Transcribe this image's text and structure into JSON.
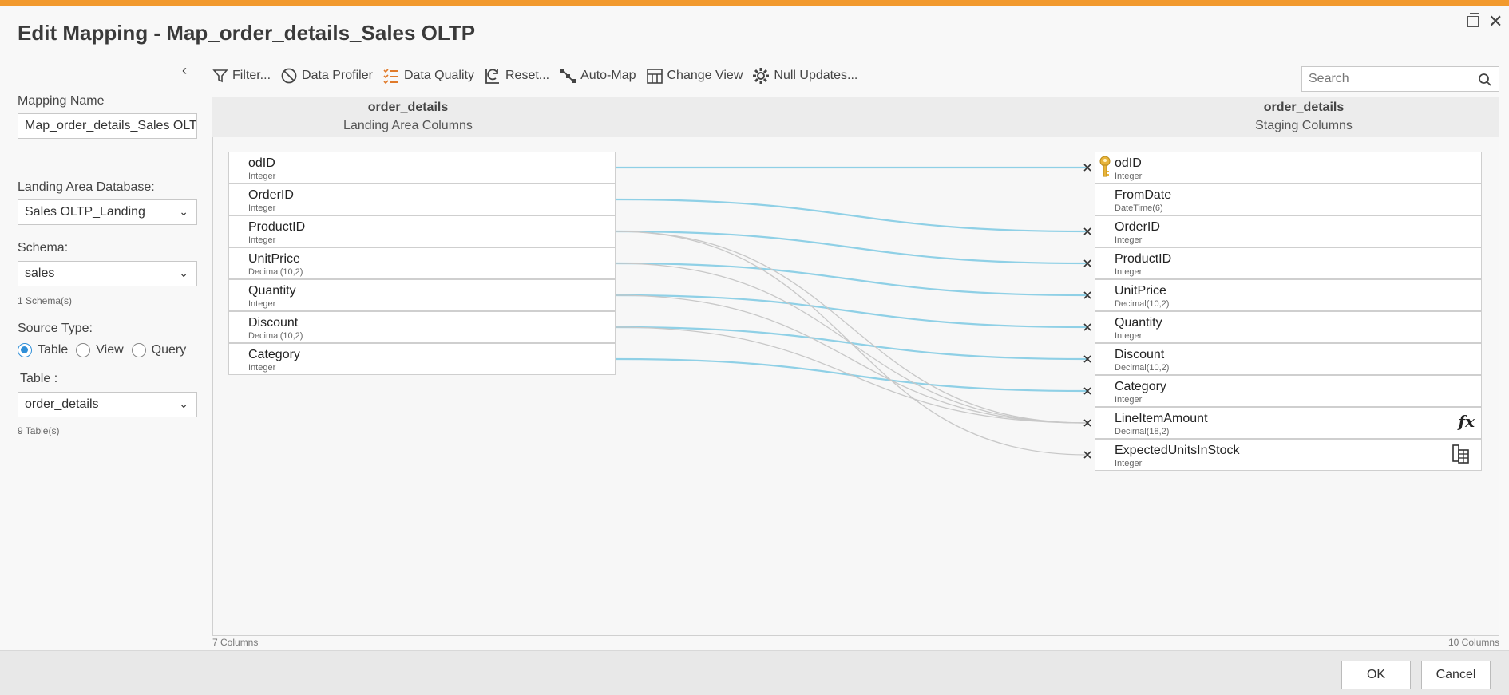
{
  "window": {
    "title": "Edit Mapping - Map_order_details_Sales OLTP"
  },
  "left_panel": {
    "mapping_name_label": "Mapping Name",
    "mapping_name_value": "Map_order_details_Sales OLTP",
    "landing_db_label": "Landing Area Database:",
    "landing_db_value": "Sales OLTP_Landing",
    "schema_label": "Schema:",
    "schema_value": "sales",
    "schema_count": "1 Schema(s)",
    "source_type_label": "Source Type:",
    "source_types": [
      "Table",
      "View",
      "Query"
    ],
    "source_type_selected": "Table",
    "table_label": "Table :",
    "table_value": "order_details",
    "table_count": "9 Table(s)"
  },
  "toolbar": {
    "items": [
      {
        "label": "Filter...",
        "icon": "filter-icon"
      },
      {
        "label": "Data Profiler",
        "icon": "data-profiler-icon"
      },
      {
        "label": "Data Quality",
        "icon": "data-quality-icon"
      },
      {
        "label": "Reset...",
        "icon": "reset-icon"
      },
      {
        "label": "Auto-Map",
        "icon": "auto-map-icon"
      },
      {
        "label": "Change View",
        "icon": "change-view-icon"
      },
      {
        "label": "Null Updates...",
        "icon": "gear-icon"
      }
    ],
    "search_placeholder": "Search"
  },
  "source": {
    "table_name": "order_details",
    "subtitle": "Landing Area Columns",
    "count": "7 Columns",
    "columns": [
      {
        "name": "odID",
        "type": "Integer"
      },
      {
        "name": "OrderID",
        "type": "Integer"
      },
      {
        "name": "ProductID",
        "type": "Integer"
      },
      {
        "name": "UnitPrice",
        "type": "Decimal(10,2)"
      },
      {
        "name": "Quantity",
        "type": "Integer"
      },
      {
        "name": "Discount",
        "type": "Decimal(10,2)"
      },
      {
        "name": "Category",
        "type": "Integer"
      }
    ]
  },
  "target": {
    "table_name": "order_details",
    "subtitle": "Staging Columns",
    "count": "10 Columns",
    "columns": [
      {
        "name": "odID",
        "type": "Integer",
        "icon": "key-icon"
      },
      {
        "name": "FromDate",
        "type": "DateTime(6)"
      },
      {
        "name": "OrderID",
        "type": "Integer"
      },
      {
        "name": "ProductID",
        "type": "Integer"
      },
      {
        "name": "UnitPrice",
        "type": "Decimal(10,2)"
      },
      {
        "name": "Quantity",
        "type": "Integer"
      },
      {
        "name": "Discount",
        "type": "Decimal(10,2)"
      },
      {
        "name": "Category",
        "type": "Integer"
      },
      {
        "name": "LineItemAmount",
        "type": "Decimal(18,2)",
        "icon": "fx-icon",
        "icon_text": "fx"
      },
      {
        "name": "ExpectedUnitsInStock",
        "type": "Integer",
        "icon": "lookup-table-icon"
      }
    ]
  },
  "mappings": [
    {
      "from": 0,
      "to": 0,
      "kind": "direct"
    },
    {
      "from": 1,
      "to": 2,
      "kind": "direct"
    },
    {
      "from": 2,
      "to": 3,
      "kind": "direct"
    },
    {
      "from": 3,
      "to": 4,
      "kind": "direct"
    },
    {
      "from": 4,
      "to": 5,
      "kind": "direct"
    },
    {
      "from": 5,
      "to": 6,
      "kind": "direct"
    },
    {
      "from": 6,
      "to": 7,
      "kind": "direct"
    },
    {
      "from": 2,
      "to": 8,
      "kind": "expression"
    },
    {
      "from": 3,
      "to": 8,
      "kind": "expression"
    },
    {
      "from": 4,
      "to": 8,
      "kind": "expression"
    },
    {
      "from": 5,
      "to": 8,
      "kind": "expression"
    },
    {
      "from": 2,
      "to": 9,
      "kind": "expression"
    }
  ],
  "colors": {
    "direct_link": "#8fd0e6",
    "expression_link": "#c8c8c8",
    "accent": "#f29a2e",
    "radio": "#2f8fd8"
  },
  "footer": {
    "ok_label": "OK",
    "cancel_label": "Cancel"
  }
}
